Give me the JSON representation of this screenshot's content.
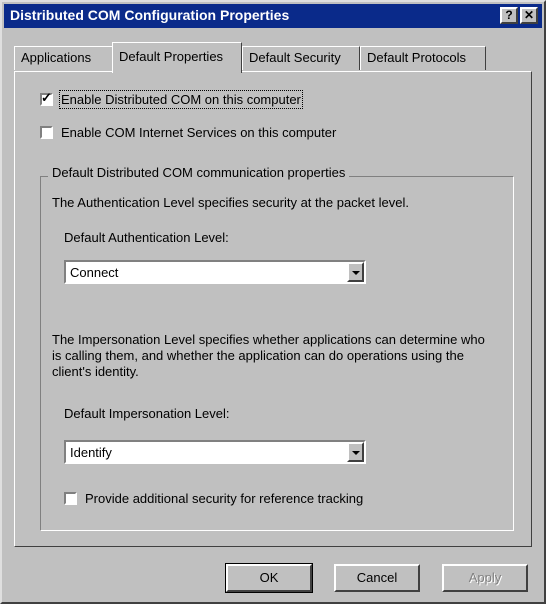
{
  "window": {
    "title": "Distributed COM Configuration Properties",
    "help_button": "?",
    "close_button": "✕"
  },
  "tabs": [
    {
      "label": "Applications",
      "active": false
    },
    {
      "label": "Default Properties",
      "active": true
    },
    {
      "label": "Default Security",
      "active": false
    },
    {
      "label": "Default Protocols",
      "active": false
    }
  ],
  "options": {
    "enable_dcom": {
      "label": "Enable Distributed COM on this computer",
      "checked": true
    },
    "enable_cis": {
      "label": "Enable COM Internet Services on this computer",
      "checked": false
    }
  },
  "group": {
    "legend": "Default Distributed COM communication properties",
    "auth_description": "The Authentication Level specifies security at the packet level.",
    "auth_label": "Default Authentication Level:",
    "auth_value": "Connect",
    "imp_description": "The Impersonation Level specifies whether applications can determine who is calling them, and whether the application can do operations using the client's identity.",
    "imp_label": "Default Impersonation Level:",
    "imp_value": "Identify",
    "ref_tracking": {
      "label": "Provide additional security for reference tracking",
      "checked": false
    }
  },
  "buttons": {
    "ok": "OK",
    "cancel": "Cancel",
    "apply": "Apply"
  },
  "colors": {
    "titlebar": "#0a2a8a",
    "face": "#c0c0c0"
  }
}
